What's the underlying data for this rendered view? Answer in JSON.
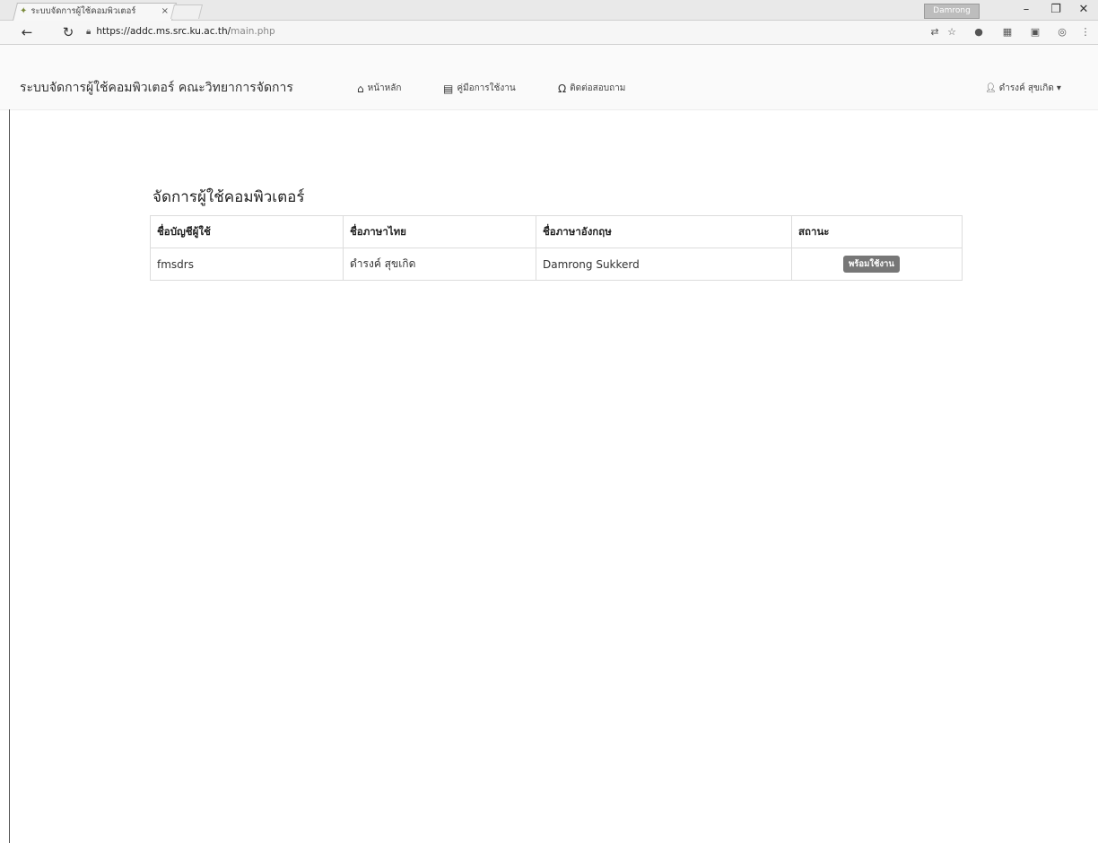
{
  "browser": {
    "tab_title": "ระบบจัดการผู้ใช้คอมพิวเตอร์",
    "tab_close": "×",
    "profile": "Damrong",
    "url_host": "https://addc.ms.src.ku.ac.th/",
    "url_path": "main.php"
  },
  "navbar": {
    "brand": "ระบบจัดการผู้ใช้คอมพิวเตอร์ คณะวิทยาการจัดการ",
    "home": "หน้าหลัก",
    "manual": "คู่มือการใช้งาน",
    "contact": "ติดต่อสอบถาม",
    "user": "ดำรงค์ สุขเกิด"
  },
  "main": {
    "title": "จัดการผู้ใช้คอมพิวเตอร์",
    "columns": [
      "ชื่อบัญชีผู้ใช้",
      "ชื่อภาษาไทย",
      "ชื่อภาษาอังกฤษ",
      "สถานะ"
    ],
    "rows": [
      {
        "username": "fmsdrs",
        "name_th": "ดำรงค์ สุขเกิด",
        "name_en": "Damrong Sukkerd",
        "status": "พร้อมใช้งาน"
      }
    ]
  },
  "colors": {
    "badge": "#777777",
    "border": "#dcdcdc"
  }
}
